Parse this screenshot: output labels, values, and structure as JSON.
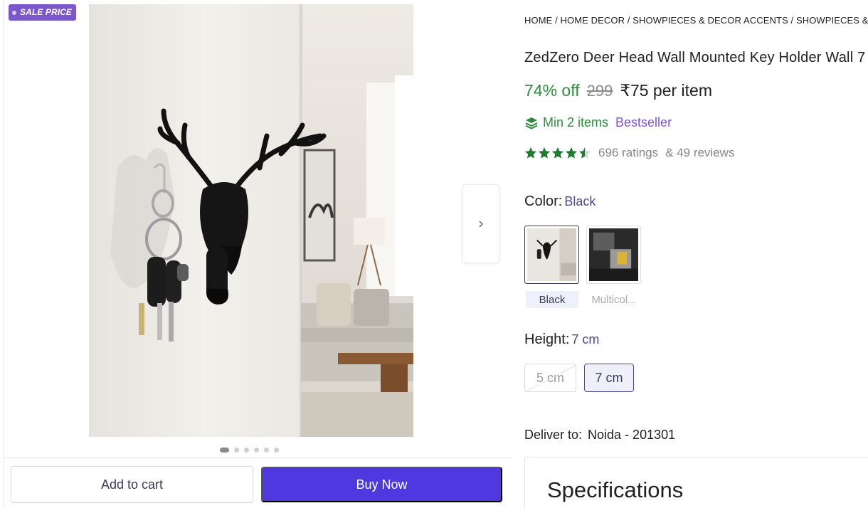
{
  "badge": {
    "label": "SALE PRICE"
  },
  "gallery": {
    "image_alt": "Deer head wall mounted key holder",
    "dot_count": 6,
    "active_dot": 0
  },
  "actions": {
    "add_to_cart": "Add to cart",
    "buy_now": "Buy Now"
  },
  "breadcrumb": "HOME / HOME DECOR / SHOWPIECES & DECOR ACCENTS / SHOWPIECES & FIGU",
  "product": {
    "title": "ZedZero Deer Head Wall Mounted Key Holder Wall 7",
    "discount": "74% off",
    "mrp": "299",
    "price": "₹75 per item",
    "min_items": "Min 2 items",
    "badge": "Bestseller",
    "rating_value": 4.5,
    "ratings": "696 ratings",
    "reviews": "& 49 reviews"
  },
  "color": {
    "label": "Color:",
    "selected": "Black",
    "options": [
      {
        "label": "Black",
        "selected": true
      },
      {
        "label": "Multicol...",
        "selected": false
      }
    ]
  },
  "height": {
    "label": "Height:",
    "selected": "7 cm",
    "options": [
      {
        "label": "5 cm",
        "available": false
      },
      {
        "label": "7 cm",
        "available": true,
        "selected": true
      }
    ]
  },
  "delivery": {
    "label": "Deliver to:",
    "location": "Noida - 201301"
  },
  "specs": {
    "title": "Specifications"
  },
  "colors": {
    "accent": "#4f38e0",
    "discount_green": "#2e8b3d",
    "bestseller_purple": "#7b57c9",
    "star_green": "#1f7a32"
  }
}
